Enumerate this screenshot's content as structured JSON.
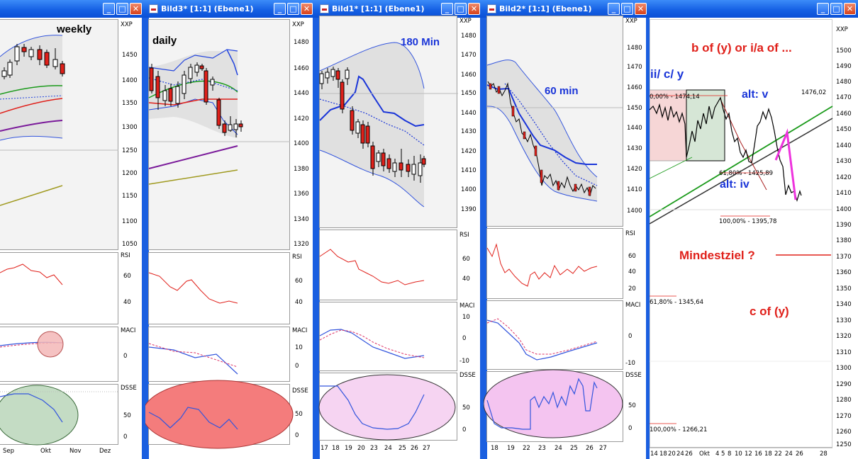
{
  "windows": {
    "w1": {
      "title": "",
      "annotation": "weekly",
      "symbol": "XXP",
      "price_ticks": [
        "1450",
        "1400",
        "1350",
        "1300",
        "1250",
        "1200",
        "1150",
        "1100",
        "1050"
      ],
      "rsi_ticks": [
        "60",
        "40"
      ],
      "macd_ticks": [
        "0"
      ],
      "dsse_ticks": [
        "50",
        "0"
      ],
      "x_ticks": [
        "Sep",
        "Okt",
        "Nov",
        "Dez"
      ]
    },
    "w2": {
      "title": "Bild3* [1:1] (Ebene1)",
      "annotation": "daily",
      "symbol": "XXP",
      "price_ticks": [
        "1480",
        "1460",
        "1440",
        "1420",
        "1400",
        "1380",
        "1360",
        "1340",
        "1320"
      ],
      "rsi_ticks": [
        "60",
        "40"
      ],
      "macd_ticks": [
        "10",
        "0"
      ],
      "dsse_ticks": [
        "50",
        "0"
      ]
    },
    "w3": {
      "title": "Bild1* [1:1] (Ebene1)",
      "annotation": "180 Min",
      "symbol": "XXP",
      "price_ticks": [
        "1480",
        "1470",
        "1460",
        "1450",
        "1440",
        "1430",
        "1420",
        "1410",
        "1400",
        "1390"
      ],
      "rsi_ticks": [
        "60",
        "40"
      ],
      "macd_ticks": [
        "10",
        "0",
        "-10"
      ],
      "dsse_ticks": [
        "50",
        "0"
      ],
      "x_ticks": [
        "17",
        "18",
        "19",
        "20",
        "23",
        "24",
        "25",
        "26",
        "27"
      ]
    },
    "w4": {
      "title": "Bild2* [1:1] (Ebene1)",
      "annotation": "60 min",
      "symbol": "XXP",
      "price_ticks": [
        "1480",
        "1470",
        "1460",
        "1450",
        "1440",
        "1430",
        "1420",
        "1410",
        "1400"
      ],
      "rsi_ticks": [
        "60",
        "40",
        "20"
      ],
      "macd_ticks": [
        "0",
        "-10"
      ],
      "dsse_ticks": [
        "50",
        "0"
      ],
      "x_ticks": [
        "18",
        "19",
        "22",
        "23",
        "24",
        "25",
        "26",
        "27"
      ]
    },
    "w5": {
      "title": "",
      "symbol": "XXP",
      "price_ticks": [
        "1500",
        "1490",
        "1480",
        "1470",
        "1460",
        "1450",
        "1440",
        "1430",
        "1420",
        "1410",
        "1400",
        "1390",
        "1380",
        "1370",
        "1360",
        "1350",
        "1340",
        "1330",
        "1320",
        "1310",
        "1300",
        "1290",
        "1280",
        "1270",
        "1260",
        "1250"
      ],
      "x_ticks": [
        "14",
        "18",
        "20",
        "24",
        "26",
        "Okt",
        "4",
        "5",
        "8",
        "10",
        "12",
        "16",
        "18",
        "22",
        "24",
        "26",
        "28"
      ]
    }
  },
  "labels": {
    "rsi": "RSI",
    "macd": "MACI",
    "dsse": "DSSE"
  },
  "annotations": {
    "wave_top": "b of (y) or i/a of ...",
    "wave_left": "ii/ c/ y",
    "alt_v": "alt: v",
    "alt_iv": "alt: iv",
    "target": "Mindestziel ?",
    "c_of_y": "c of (y)",
    "last_price": "1476,02",
    "fib_0": "0,00% - 1474,14",
    "fib_618_up": "61,80% - 1425,89",
    "fib_100_up": "100,00% - 1395,78",
    "fib_618_low": "61,80% - 1345,64",
    "fib_100_low": "100,00% - 1266,21"
  },
  "colors": {
    "title_bar": "#1661e4",
    "red": "#e0201a",
    "blue": "#1a35d8",
    "pink": "#ee33dd",
    "green": "#1a9a1a"
  },
  "titlebar_buttons": {
    "minimize": "_",
    "maximize": "□",
    "close": "✕"
  }
}
